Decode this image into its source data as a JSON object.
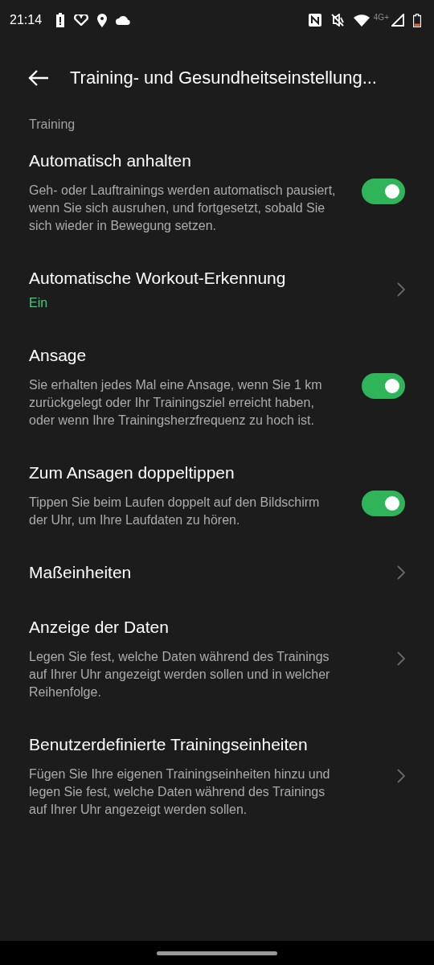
{
  "status_bar": {
    "time": "21:14",
    "network": "4G+"
  },
  "header": {
    "title": "Training- und Gesundheitseinstellung..."
  },
  "section": "Training",
  "items": [
    {
      "kind": "toggle",
      "title": "Automatisch anhalten",
      "description": "Geh- oder Lauftrainings werden automatisch pausiert, wenn Sie sich ausruhen, und fortgesetzt, sobald Sie sich wieder in Bewegung setzen.",
      "on": true
    },
    {
      "kind": "link",
      "title": "Automatische Workout-Erkennung",
      "value": "Ein"
    },
    {
      "kind": "toggle",
      "title": "Ansage",
      "description": "Sie erhalten jedes Mal eine Ansage, wenn Sie 1 km zurückgelegt oder Ihr Trainingsziel erreicht haben, oder wenn Ihre Trainingsherzfrequenz zu hoch ist.",
      "on": true
    },
    {
      "kind": "toggle",
      "title": "Zum Ansagen doppeltippen",
      "description": "Tippen Sie beim Laufen doppelt auf den Bildschirm der Uhr, um Ihre Laufdaten zu hören.",
      "on": true
    },
    {
      "kind": "link",
      "title": "Maßeinheiten"
    },
    {
      "kind": "link",
      "title": "Anzeige der Daten",
      "description": "Legen Sie fest, welche Daten während des Trainings auf Ihrer Uhr angezeigt werden sollen und in welcher Reihenfolge."
    },
    {
      "kind": "link",
      "title": "Benutzerdefinierte Trainingseinheiten",
      "description": "Fügen Sie Ihre eigenen Trainingseinheiten hinzu und legen Sie fest, welche Daten während des Trainings auf Ihrer Uhr angezeigt werden sollen."
    }
  ]
}
